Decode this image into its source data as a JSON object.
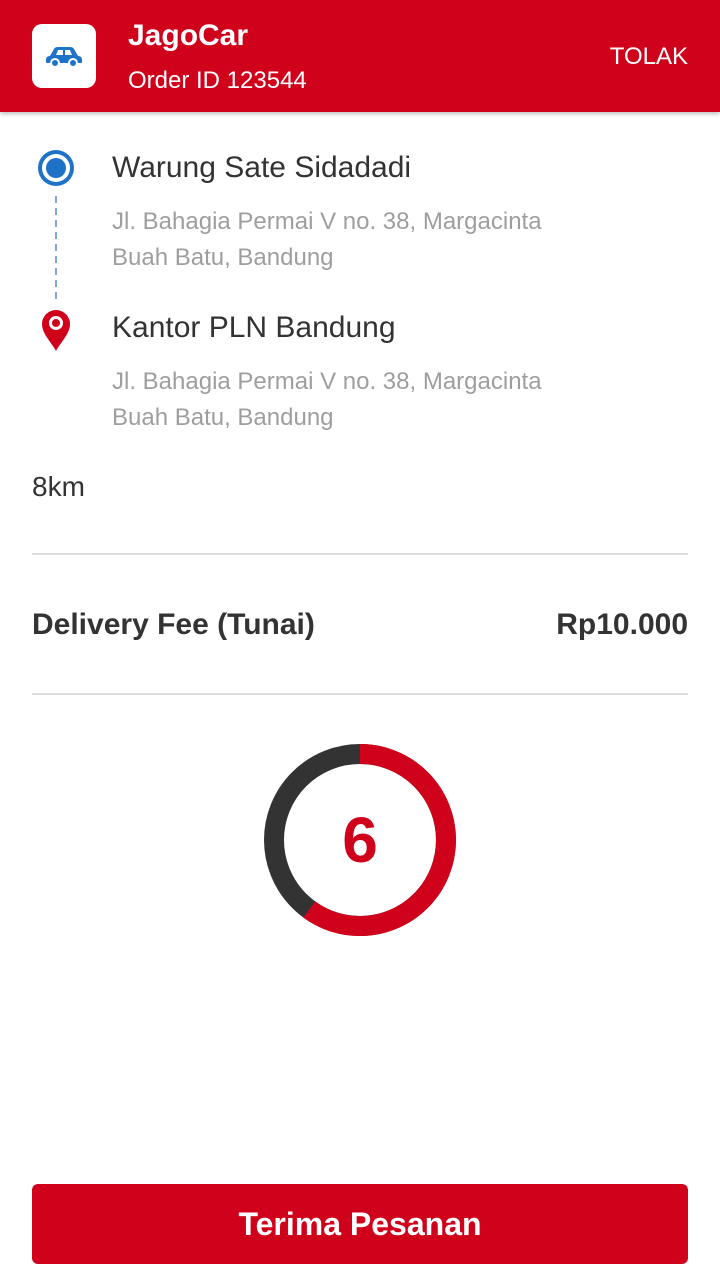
{
  "header": {
    "app_icon": "car-icon",
    "title": "JagoCar",
    "order_id": "Order ID 123544",
    "reject_label": "TOLAK"
  },
  "route": {
    "pickup": {
      "icon": "origin-dot-icon",
      "name": "Warung Sate Sidadadi",
      "address_line1": "Jl. Bahagia Permai V no. 38, Margacinta",
      "address_line2": "Buah Batu, Bandung"
    },
    "dropoff": {
      "icon": "map-pin-icon",
      "name": "Kantor PLN Bandung",
      "address_line1": "Jl. Bahagia Permai V no. 38, Margacinta",
      "address_line2": "Buah Batu, Bandung"
    },
    "distance": "8km"
  },
  "fee": {
    "label": "Delivery Fee (Tunai)",
    "value": "Rp10.000"
  },
  "timer": {
    "value": "6",
    "remaining_fraction": 0.6
  },
  "actions": {
    "accept_label": "Terima Pesanan"
  },
  "colors": {
    "brand_red": "#d0021b",
    "pickup_blue": "#1e73c8",
    "text_dark": "#333333",
    "text_muted": "#9e9e9e",
    "timer_track": "#333333"
  }
}
